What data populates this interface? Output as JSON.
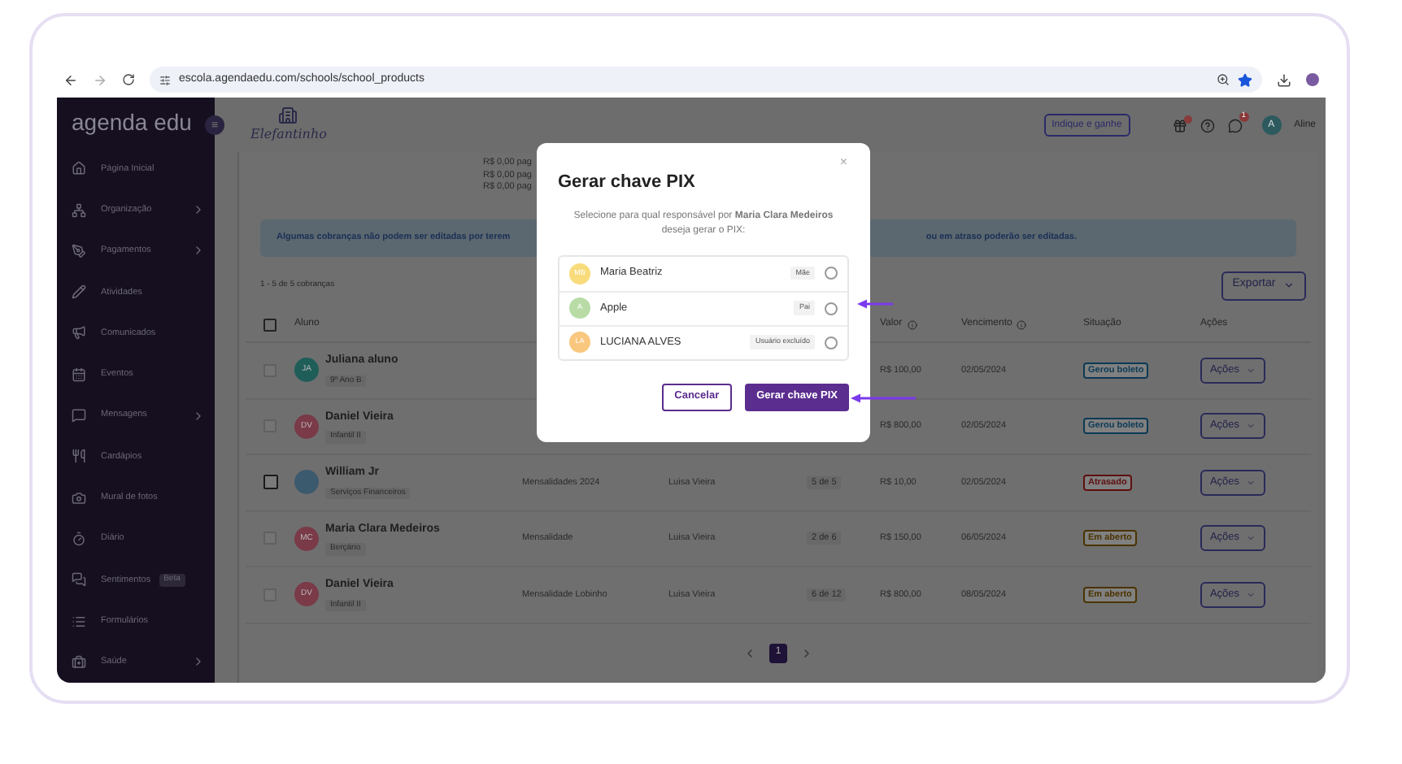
{
  "browser": {
    "url": "escola.agendaedu.com/schools/school_products"
  },
  "sidebar": {
    "logo": "agenda edu",
    "collapse": "≡",
    "items": [
      {
        "label": "Página Inicial",
        "has_submenu": false
      },
      {
        "label": "Organização",
        "has_submenu": true
      },
      {
        "label": "Pagamentos",
        "has_submenu": true
      },
      {
        "label": "Atividades",
        "has_submenu": false
      },
      {
        "label": "Comunicados",
        "has_submenu": false
      },
      {
        "label": "Eventos",
        "has_submenu": false
      },
      {
        "label": "Mensagens",
        "has_submenu": true
      },
      {
        "label": "Cardápios",
        "has_submenu": false
      },
      {
        "label": "Mural de fotos",
        "has_submenu": false
      },
      {
        "label": "Diário",
        "has_submenu": false
      },
      {
        "label": "Sentimentos",
        "has_submenu": false,
        "badge": "Beta"
      },
      {
        "label": "Formulários",
        "has_submenu": false
      },
      {
        "label": "Saúde",
        "has_submenu": true
      }
    ]
  },
  "topbar": {
    "school": "Elefantinho",
    "referral_button": "Indique e ganhe",
    "chat_badge": "1",
    "user_initial": "A",
    "user_name": "Aline"
  },
  "summary_lines": [
    "R$ 0,00 pag",
    "R$ 0,00 pag",
    "R$ 0,00 pag"
  ],
  "alert": {
    "left": "Algumas cobranças não podem ser editadas por terem",
    "right": "ou em atraso poderão ser editadas."
  },
  "count": "1 - 5 de 5 cobranças",
  "export_button": "Exportar",
  "table": {
    "select_all": {
      "checked": false
    },
    "columns": [
      {
        "label": "Aluno",
        "info": false
      },
      {
        "label": "Valor",
        "info": true
      },
      {
        "label": "Vencimento",
        "info": true
      },
      {
        "label": "Situação",
        "info": false
      },
      {
        "label": "Ações",
        "info": false
      }
    ],
    "rows": [
      {
        "disabled": true,
        "name": "Juliana aluno",
        "class": "9º Ano B",
        "avatar": {
          "kind": "initials",
          "initials": "JA",
          "color": "#1f5d59"
        },
        "value": "R$ 100,00",
        "due": "02/05/2024",
        "status": {
          "text": "Gerou boleto",
          "color": "#0b3a55"
        },
        "action": "Ações"
      },
      {
        "disabled": true,
        "name": "Daniel Vieira",
        "class": "Infantil II",
        "avatar": {
          "kind": "initials",
          "initials": "DV",
          "color": "#7a3a48"
        },
        "value": "R$ 800,00",
        "due": "02/05/2024",
        "status": {
          "text": "Gerou boleto",
          "color": "#0b3a55"
        },
        "action": "Ações"
      },
      {
        "disabled": false,
        "name": "William Jr",
        "class": "Serviços Financeiros",
        "avatar": {
          "kind": "photo"
        },
        "plan": "Mensalidades 2024",
        "responsible": "Luisa Vieira",
        "installment": "5 de 5",
        "value": "R$ 10,00",
        "due": "02/05/2024",
        "status": {
          "text": "Atrasado",
          "color": "#5e0f0f"
        },
        "action": "Ações"
      },
      {
        "disabled": true,
        "name": "Maria Clara Medeiros",
        "class": "Berçário",
        "avatar": {
          "kind": "initials",
          "initials": "MC",
          "color": "#7a3a48"
        },
        "plan": "Mensalidade",
        "responsible": "Luisa Vieira",
        "installment": "2 de 6",
        "value": "R$ 150,00",
        "due": "06/05/2024",
        "status": {
          "text": "Em aberto",
          "color": "#4a3300"
        },
        "action": "Ações"
      },
      {
        "disabled": true,
        "name": "Daniel Vieira",
        "class": "Infantil II",
        "avatar": {
          "kind": "initials",
          "initials": "DV",
          "color": "#7a3a48"
        },
        "plan": "Mensalidade Lobinho",
        "responsible": "Luisa Vieira",
        "installment": "6 de 12",
        "value": "R$ 800,00",
        "due": "08/05/2024",
        "status": {
          "text": "Em aberto",
          "color": "#4a3300"
        },
        "action": "Ações"
      }
    ]
  },
  "pagination": {
    "pages": [
      {
        "label": "1",
        "selected": true
      }
    ]
  },
  "modal": {
    "title": "Gerar chave PIX",
    "close": "×",
    "description": "Selecione para qual responsável por **Maria Clara Medeiros** deseja gerar o PIX:",
    "options": [
      {
        "initials": "MB",
        "name": "Maria Beatriz",
        "tag": "Mãe",
        "color": "#f8dc7c",
        "selected": false
      },
      {
        "initials": "A",
        "name": "Apple",
        "tag": "Pai",
        "color": "#b9dca6",
        "selected": false
      },
      {
        "initials": "LA",
        "name": "LUCIANA ALVES",
        "tag": "Usuário excluído",
        "color": "#f9c77e",
        "selected": false
      }
    ],
    "buttons": [
      {
        "label": "Cancelar",
        "kind": "secondary"
      },
      {
        "label": "Gerar chave PIX",
        "kind": "primary"
      }
    ]
  }
}
